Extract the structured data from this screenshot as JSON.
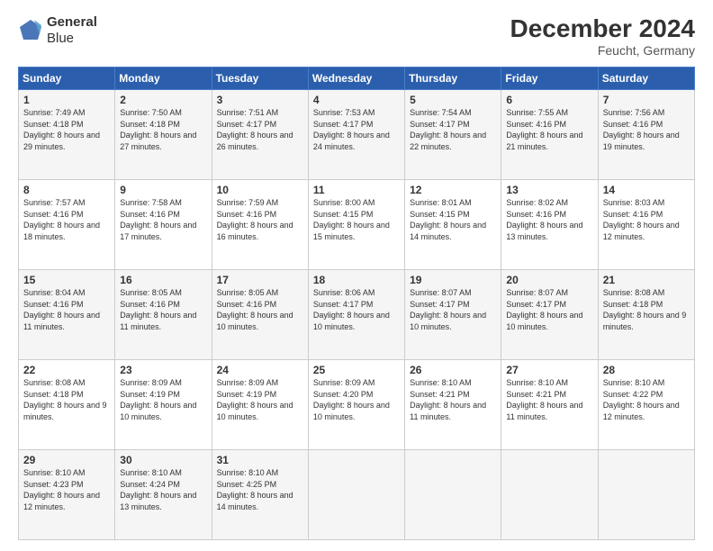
{
  "logo": {
    "line1": "General",
    "line2": "Blue"
  },
  "title": "December 2024",
  "subtitle": "Feucht, Germany",
  "weekdays": [
    "Sunday",
    "Monday",
    "Tuesday",
    "Wednesday",
    "Thursday",
    "Friday",
    "Saturday"
  ],
  "weeks": [
    [
      {
        "day": "1",
        "sunrise": "Sunrise: 7:49 AM",
        "sunset": "Sunset: 4:18 PM",
        "daylight": "Daylight: 8 hours and 29 minutes."
      },
      {
        "day": "2",
        "sunrise": "Sunrise: 7:50 AM",
        "sunset": "Sunset: 4:18 PM",
        "daylight": "Daylight: 8 hours and 27 minutes."
      },
      {
        "day": "3",
        "sunrise": "Sunrise: 7:51 AM",
        "sunset": "Sunset: 4:17 PM",
        "daylight": "Daylight: 8 hours and 26 minutes."
      },
      {
        "day": "4",
        "sunrise": "Sunrise: 7:53 AM",
        "sunset": "Sunset: 4:17 PM",
        "daylight": "Daylight: 8 hours and 24 minutes."
      },
      {
        "day": "5",
        "sunrise": "Sunrise: 7:54 AM",
        "sunset": "Sunset: 4:17 PM",
        "daylight": "Daylight: 8 hours and 22 minutes."
      },
      {
        "day": "6",
        "sunrise": "Sunrise: 7:55 AM",
        "sunset": "Sunset: 4:16 PM",
        "daylight": "Daylight: 8 hours and 21 minutes."
      },
      {
        "day": "7",
        "sunrise": "Sunrise: 7:56 AM",
        "sunset": "Sunset: 4:16 PM",
        "daylight": "Daylight: 8 hours and 19 minutes."
      }
    ],
    [
      {
        "day": "8",
        "sunrise": "Sunrise: 7:57 AM",
        "sunset": "Sunset: 4:16 PM",
        "daylight": "Daylight: 8 hours and 18 minutes."
      },
      {
        "day": "9",
        "sunrise": "Sunrise: 7:58 AM",
        "sunset": "Sunset: 4:16 PM",
        "daylight": "Daylight: 8 hours and 17 minutes."
      },
      {
        "day": "10",
        "sunrise": "Sunrise: 7:59 AM",
        "sunset": "Sunset: 4:16 PM",
        "daylight": "Daylight: 8 hours and 16 minutes."
      },
      {
        "day": "11",
        "sunrise": "Sunrise: 8:00 AM",
        "sunset": "Sunset: 4:15 PM",
        "daylight": "Daylight: 8 hours and 15 minutes."
      },
      {
        "day": "12",
        "sunrise": "Sunrise: 8:01 AM",
        "sunset": "Sunset: 4:15 PM",
        "daylight": "Daylight: 8 hours and 14 minutes."
      },
      {
        "day": "13",
        "sunrise": "Sunrise: 8:02 AM",
        "sunset": "Sunset: 4:16 PM",
        "daylight": "Daylight: 8 hours and 13 minutes."
      },
      {
        "day": "14",
        "sunrise": "Sunrise: 8:03 AM",
        "sunset": "Sunset: 4:16 PM",
        "daylight": "Daylight: 8 hours and 12 minutes."
      }
    ],
    [
      {
        "day": "15",
        "sunrise": "Sunrise: 8:04 AM",
        "sunset": "Sunset: 4:16 PM",
        "daylight": "Daylight: 8 hours and 11 minutes."
      },
      {
        "day": "16",
        "sunrise": "Sunrise: 8:05 AM",
        "sunset": "Sunset: 4:16 PM",
        "daylight": "Daylight: 8 hours and 11 minutes."
      },
      {
        "day": "17",
        "sunrise": "Sunrise: 8:05 AM",
        "sunset": "Sunset: 4:16 PM",
        "daylight": "Daylight: 8 hours and 10 minutes."
      },
      {
        "day": "18",
        "sunrise": "Sunrise: 8:06 AM",
        "sunset": "Sunset: 4:17 PM",
        "daylight": "Daylight: 8 hours and 10 minutes."
      },
      {
        "day": "19",
        "sunrise": "Sunrise: 8:07 AM",
        "sunset": "Sunset: 4:17 PM",
        "daylight": "Daylight: 8 hours and 10 minutes."
      },
      {
        "day": "20",
        "sunrise": "Sunrise: 8:07 AM",
        "sunset": "Sunset: 4:17 PM",
        "daylight": "Daylight: 8 hours and 10 minutes."
      },
      {
        "day": "21",
        "sunrise": "Sunrise: 8:08 AM",
        "sunset": "Sunset: 4:18 PM",
        "daylight": "Daylight: 8 hours and 9 minutes."
      }
    ],
    [
      {
        "day": "22",
        "sunrise": "Sunrise: 8:08 AM",
        "sunset": "Sunset: 4:18 PM",
        "daylight": "Daylight: 8 hours and 9 minutes."
      },
      {
        "day": "23",
        "sunrise": "Sunrise: 8:09 AM",
        "sunset": "Sunset: 4:19 PM",
        "daylight": "Daylight: 8 hours and 10 minutes."
      },
      {
        "day": "24",
        "sunrise": "Sunrise: 8:09 AM",
        "sunset": "Sunset: 4:19 PM",
        "daylight": "Daylight: 8 hours and 10 minutes."
      },
      {
        "day": "25",
        "sunrise": "Sunrise: 8:09 AM",
        "sunset": "Sunset: 4:20 PM",
        "daylight": "Daylight: 8 hours and 10 minutes."
      },
      {
        "day": "26",
        "sunrise": "Sunrise: 8:10 AM",
        "sunset": "Sunset: 4:21 PM",
        "daylight": "Daylight: 8 hours and 11 minutes."
      },
      {
        "day": "27",
        "sunrise": "Sunrise: 8:10 AM",
        "sunset": "Sunset: 4:21 PM",
        "daylight": "Daylight: 8 hours and 11 minutes."
      },
      {
        "day": "28",
        "sunrise": "Sunrise: 8:10 AM",
        "sunset": "Sunset: 4:22 PM",
        "daylight": "Daylight: 8 hours and 12 minutes."
      }
    ],
    [
      {
        "day": "29",
        "sunrise": "Sunrise: 8:10 AM",
        "sunset": "Sunset: 4:23 PM",
        "daylight": "Daylight: 8 hours and 12 minutes."
      },
      {
        "day": "30",
        "sunrise": "Sunrise: 8:10 AM",
        "sunset": "Sunset: 4:24 PM",
        "daylight": "Daylight: 8 hours and 13 minutes."
      },
      {
        "day": "31",
        "sunrise": "Sunrise: 8:10 AM",
        "sunset": "Sunset: 4:25 PM",
        "daylight": "Daylight: 8 hours and 14 minutes."
      },
      null,
      null,
      null,
      null
    ]
  ]
}
